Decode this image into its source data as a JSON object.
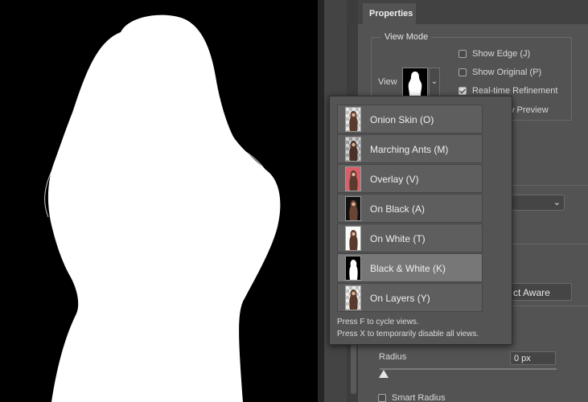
{
  "properties_panel": {
    "tab_label": "Properties",
    "view_mode": {
      "title": "View Mode",
      "view_label": "View",
      "show_edge": {
        "label": "Show Edge (J)",
        "checked": false
      },
      "show_original": {
        "label": "Show Original (P)",
        "checked": false
      },
      "realtime_refinement": {
        "label": "Real-time Refinement",
        "checked": true
      },
      "preview_partial": "y Preview"
    },
    "partial_field_text": "ct Aware",
    "radius": {
      "label": "Radius",
      "value": "0 px"
    },
    "smart_radius": {
      "label": "Smart Radius",
      "checked": false
    }
  },
  "view_menu": {
    "items": [
      {
        "label": "Onion Skin (O)",
        "thumb": "onion-skin",
        "selected": false
      },
      {
        "label": "Marching Ants (M)",
        "thumb": "marching-ants",
        "selected": false
      },
      {
        "label": "Overlay (V)",
        "thumb": "overlay",
        "selected": false
      },
      {
        "label": "On Black (A)",
        "thumb": "on-black",
        "selected": false
      },
      {
        "label": "On White (T)",
        "thumb": "on-white",
        "selected": false
      },
      {
        "label": "Black & White (K)",
        "thumb": "black-and-white",
        "selected": true
      },
      {
        "label": "On Layers (Y)",
        "thumb": "on-layers",
        "selected": false
      }
    ],
    "hint_cycle": "Press F to cycle views.",
    "hint_disable": "Press X to temporarily disable all views."
  },
  "colors": {
    "canvas_bg": "#000000",
    "mask": "#ffffff",
    "panel_bg": "#535353",
    "overlay_thumb": "#d9606a",
    "selected_item": "#777777"
  }
}
